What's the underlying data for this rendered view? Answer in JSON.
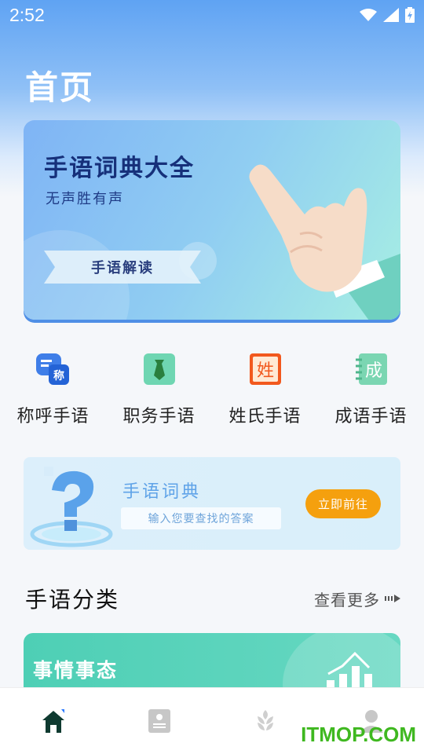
{
  "status": {
    "time": "2:52"
  },
  "page": {
    "title": "首页"
  },
  "banner": {
    "title": "手语词典大全",
    "subtitle": "无声胜有声",
    "ribbon": "手语解读"
  },
  "quick": [
    {
      "label": "称呼手语",
      "icon": "appellation-icon",
      "icon_text": "称"
    },
    {
      "label": "职务手语",
      "icon": "tie-icon"
    },
    {
      "label": "姓氏手语",
      "icon": "surname-icon",
      "icon_text": "姓"
    },
    {
      "label": "成语手语",
      "icon": "idiom-icon",
      "icon_text": "成"
    }
  ],
  "dict": {
    "title": "手语词典",
    "placeholder": "输入您要查找的答案",
    "button": "立即前往"
  },
  "section": {
    "title": "手语分类",
    "more": "查看更多"
  },
  "category": {
    "title": "事情事态"
  },
  "nav": [
    "home-icon",
    "contacts-icon",
    "wheat-icon",
    "profile-icon"
  ],
  "watermark": "ITMOP.COM",
  "colors": {
    "accent": "#f5a00e",
    "primary": "#5fa3f3",
    "teal": "#4ecfb5"
  }
}
